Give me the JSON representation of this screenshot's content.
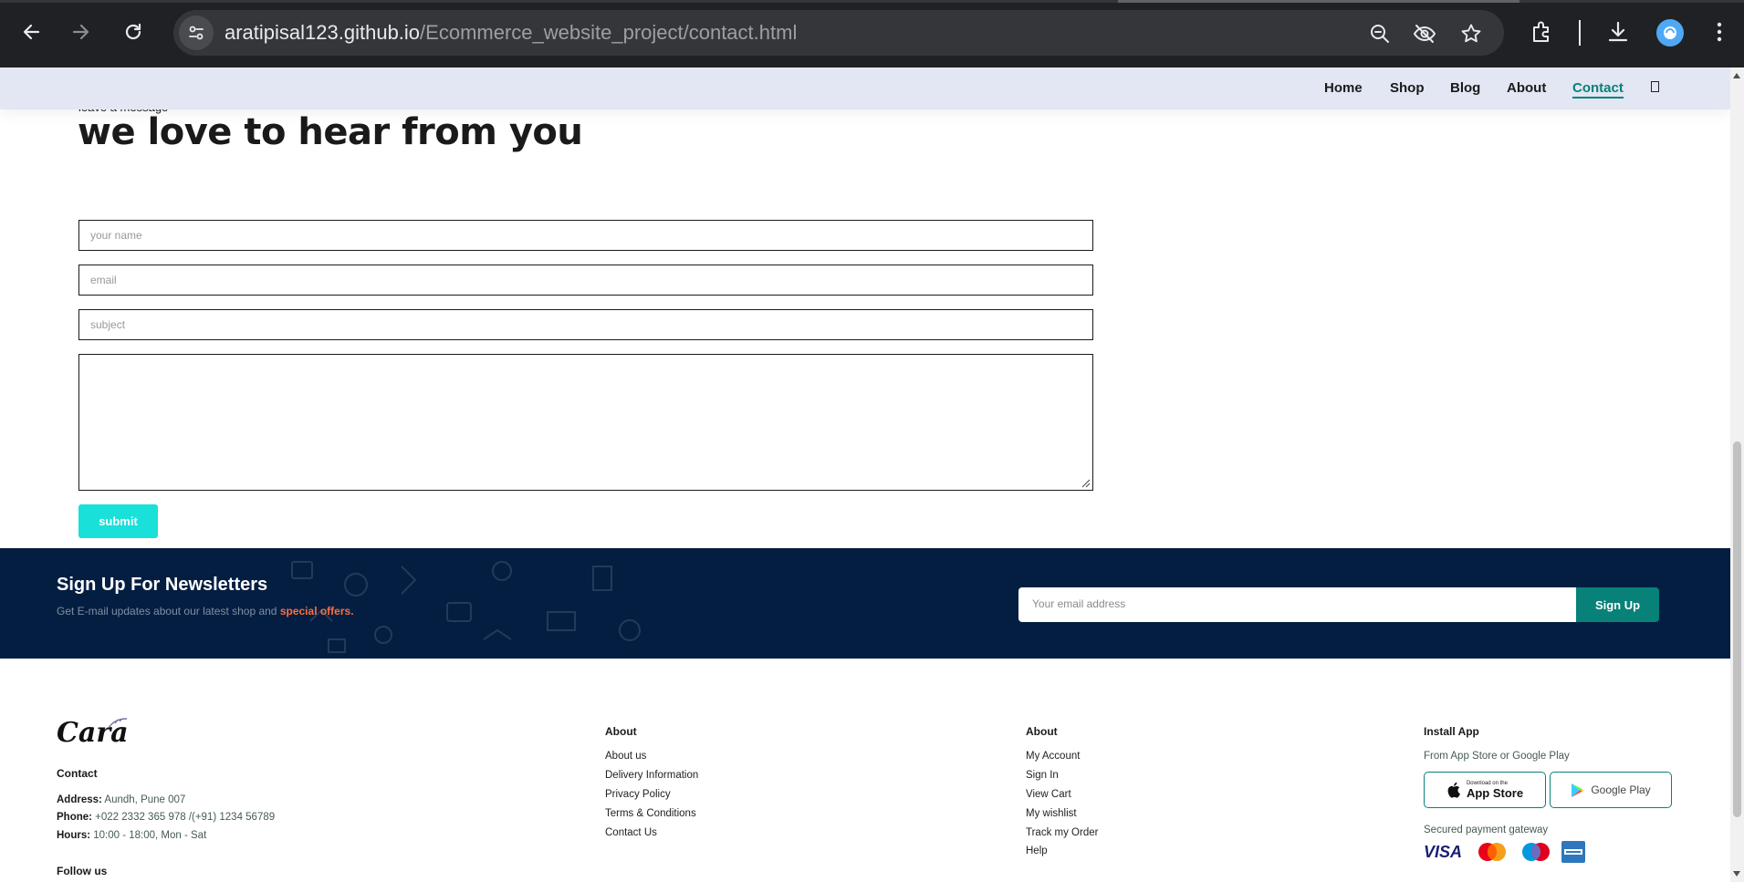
{
  "browser": {
    "url_host": "aratipisal123.github.io",
    "url_path": "/Ecommerce_website_project/contact.html"
  },
  "nav": {
    "items": [
      {
        "label": "Home"
      },
      {
        "label": "Shop"
      },
      {
        "label": "Blog"
      },
      {
        "label": "About"
      },
      {
        "label": "Contact"
      }
    ],
    "active": "Contact",
    "bag_icon": "shopping-bag-icon"
  },
  "form": {
    "kicker": "leave a message",
    "title": "we love to hear from you",
    "name_placeholder": "your name",
    "email_placeholder": "email",
    "subject_placeholder": "subject",
    "message_value": "",
    "submit_label": "submit",
    "submit_color": "#19e0d8"
  },
  "newsletter": {
    "title": "Sign Up For Newsletters",
    "subtitle_before": "Get E-mail updates about our latest shop and ",
    "subtitle_highlight": "special offers.",
    "input_placeholder": "Your email address",
    "button_label": "Sign Up",
    "bg_color": "#041e42",
    "accent": "#088178"
  },
  "footer": {
    "logo_text": "Cara",
    "contact_heading": "Contact",
    "address_label": "Address:",
    "address_value": " Aundh, Pune 007",
    "phone_label": "Phone:",
    "phone_value": " +022 2332 365 978 /(+91) 1234 56789",
    "hours_label": "Hours:",
    "hours_value": " 10:00 - 18:00, Mon - Sat",
    "follow_heading": "Follow us",
    "col1": {
      "heading": "About",
      "links": [
        "About us",
        "Delivery Information",
        "Privacy Policy",
        "Terms & Conditions",
        "Contact Us"
      ]
    },
    "col2": {
      "heading": "About",
      "links": [
        "My Account",
        "Sign In",
        "View Cart",
        "My wishlist",
        "Track my Order",
        "Help"
      ]
    },
    "install": {
      "heading": "Install App",
      "subtitle": "From App Store or Google Play",
      "appstore_small": "Download on the",
      "appstore_big": "App Store",
      "googleplay": "Google Play",
      "secured": "Secured payment gateway",
      "payments": [
        "VISA",
        "MasterCard",
        "Maestro",
        "American Express"
      ]
    }
  }
}
